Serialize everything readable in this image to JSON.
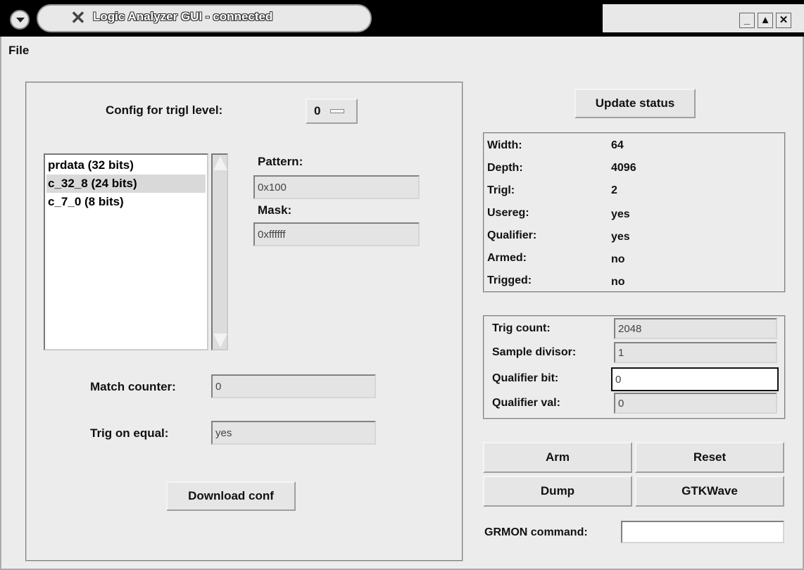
{
  "window": {
    "title": "Logic Analyzer GUI - connected"
  },
  "menu": {
    "file": "File"
  },
  "config": {
    "trig_level_label": "Config for trigl level:",
    "trig_level_value": "0",
    "signals": [
      "prdata (32 bits)",
      "c_32_8 (24 bits)",
      "c_7_0 (8 bits)"
    ],
    "selected_signal_index": 1,
    "pattern_label": "Pattern:",
    "pattern_value": "0x100",
    "mask_label": "Mask:",
    "mask_value": "0xffffff",
    "match_counter_label": "Match counter:",
    "match_counter_value": "0",
    "trig_on_equal_label": "Trig on equal:",
    "trig_on_equal_value": "yes",
    "download_button": "Download conf"
  },
  "status": {
    "update_button": "Update status",
    "rows": [
      {
        "label": "Width:",
        "value": "64"
      },
      {
        "label": "Depth:",
        "value": "4096"
      },
      {
        "label": "Trigl:",
        "value": "2"
      },
      {
        "label": "Usereg:",
        "value": "yes"
      },
      {
        "label": "Qualifier:",
        "value": "yes"
      },
      {
        "label": "Armed:",
        "value": "no"
      },
      {
        "label": "Trigged:",
        "value": "no"
      }
    ]
  },
  "settings": {
    "trig_count_label": "Trig count:",
    "trig_count_value": "2048",
    "sample_divisor_label": "Sample divisor:",
    "sample_divisor_value": "1",
    "qualifier_bit_label": "Qualifier bit:",
    "qualifier_bit_value": "0",
    "qualifier_val_label": "Qualifier val:",
    "qualifier_val_value": "0"
  },
  "actions": {
    "arm": "Arm",
    "reset": "Reset",
    "dump": "Dump",
    "gtkwave": "GTKWave",
    "grmon_label": "GRMON command:",
    "grmon_value": ""
  }
}
